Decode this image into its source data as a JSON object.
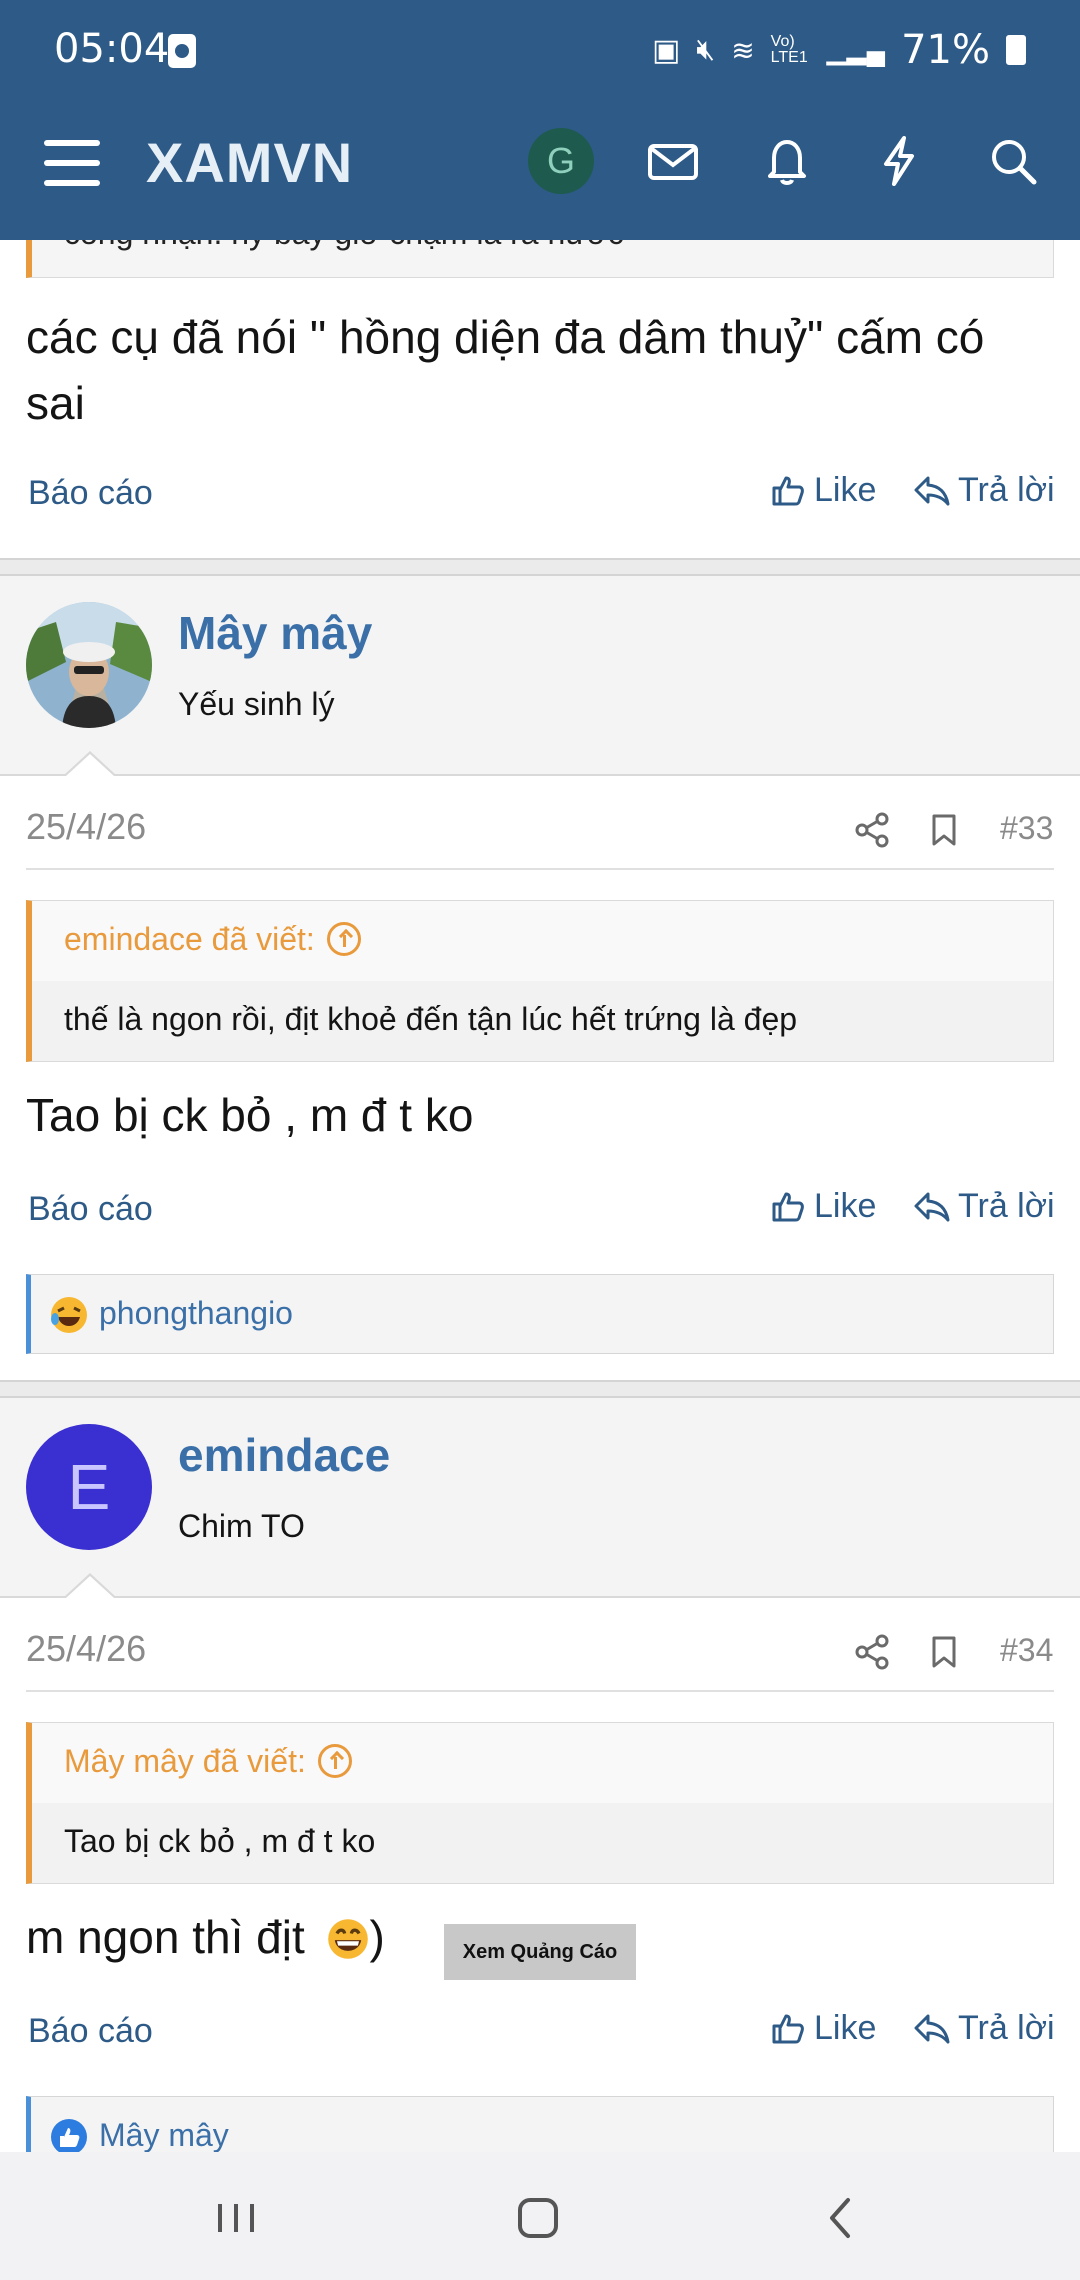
{
  "status_bar": {
    "time": "05:04",
    "signal_labels": "Vo) LTE1",
    "battery": "71%"
  },
  "header": {
    "logo": "XAMVN",
    "avatar_letter": "G",
    "brand_color": "#2d5a87"
  },
  "post_prev": {
    "quote_tail": "công nhận. hy bây giờ chạm là ra nước",
    "text": "các cụ đã nói \" hồng diện đa dâm thuỷ\" cấm có sai",
    "report": "Báo cáo",
    "like": "Like",
    "reply": "Trả lời"
  },
  "post_33": {
    "user_name": "Mây mây",
    "user_title": "Yếu sinh lý",
    "date": "25/4/26",
    "number": "#33",
    "quote_author": "emindace đã viết:",
    "quote_text": "thế là ngon rồi, địt khoẻ đến tận lúc hết trứng là đẹp",
    "text": "Tao bị ck bỏ , m đ t ko",
    "report": "Báo cáo",
    "like": "Like",
    "reply": "Trả lời",
    "reaction_user": "phongthangio"
  },
  "post_34": {
    "user_name": "emindace",
    "user_initial": "E",
    "user_title": "Chim TO",
    "date": "25/4/26",
    "number": "#34",
    "quote_author": "Mây mây đã viết:",
    "quote_text": "Tao bị ck bỏ , m đ t ko",
    "text": "m ngon thì địt",
    "text_tail": ")",
    "report": "Báo cáo",
    "like": "Like",
    "reply": "Trả lời",
    "reaction_user": "Mây mây"
  },
  "ad": {
    "label": "Xem Quảng Cáo"
  },
  "colors": {
    "link": "#2d5a87",
    "quote_accent": "#e89a3c",
    "avatar_e": "#3a2fd0"
  }
}
